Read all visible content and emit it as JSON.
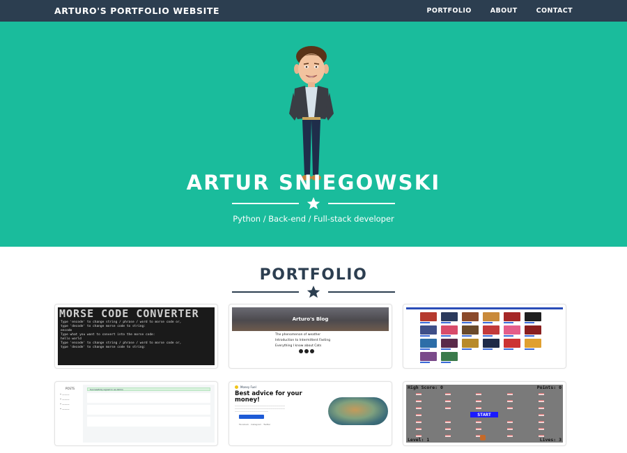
{
  "navbar": {
    "brand": "ARTURO'S PORTFOLIO WEBSITE",
    "items": [
      "PORTFOLIO",
      "ABOUT",
      "CONTACT"
    ]
  },
  "hero": {
    "name": "ARTUR SNIEGOWSKI",
    "subtitle": "Python / Back-end / Full-stack developer"
  },
  "portfolio": {
    "title": "PORTFOLIO",
    "tiles": [
      {
        "big_title": "MORSE CODE CONVERTER",
        "console_lines": [
          "Type 'encode' to change string / phrase / word to morse code or,",
          "type 'decode' to change morse code to string:",
          "encode",
          "Type what you want to convert into the morse code:",
          "hello world",
          "Type 'encode' to change string / phrase / word to morse code or,",
          "type 'decode' to change morse code to string:"
        ]
      },
      {
        "blog_title": "Arturo's Blog",
        "posts": [
          "The phenomenon of weather",
          "Introduction to Intermittent Fasting",
          "Everything I know about Cats"
        ]
      },
      {},
      {
        "sidebar_title": "POSTS",
        "alert": "Successfully signed in as Admin"
      },
      {
        "brand": "Money Fuel",
        "headline": "Best advice for your money!",
        "footer": [
          "Facebook",
          "Instagram",
          "Twitter"
        ]
      },
      {
        "high_score": "High Score: 0",
        "points": "Points: 0",
        "start": "START",
        "level": "Level: 1",
        "lives": "Lives: 3"
      }
    ]
  },
  "colors": {
    "navbar": "#2c3e50",
    "hero": "#1abc9c",
    "text": "#2c3e50"
  }
}
